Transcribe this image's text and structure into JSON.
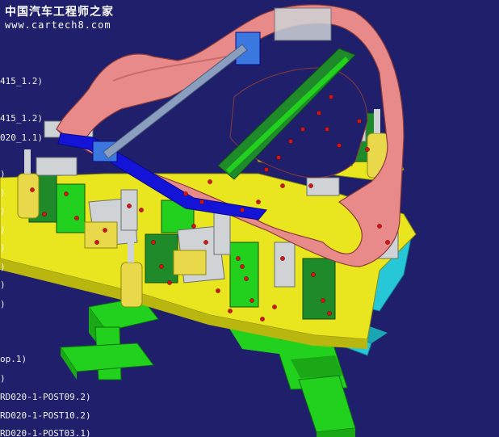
{
  "watermark": {
    "title_cn": "中国汽车工程师之家",
    "url": "www.cartech8.com"
  },
  "spec_tree": {
    "items": [
      {
        "label": "415_1.2)"
      },
      {
        "label": "415_1.2)"
      },
      {
        "label": "020_1.1)"
      },
      {
        "label": ")"
      },
      {
        "label": ")"
      },
      {
        "label": ")"
      },
      {
        "label": ")"
      },
      {
        "label": ")"
      },
      {
        "label": ")"
      },
      {
        "label": ")"
      },
      {
        "label": ")"
      },
      {
        "label": "op.1)"
      },
      {
        "label": ")"
      },
      {
        "label": "RD020-1-POST09.2)"
      },
      {
        "label": "RD020-1-POST10.2)"
      },
      {
        "label": "RD020-1-POST03.1)"
      }
    ]
  },
  "colors": {
    "background": "#1f1f6b",
    "body_panel": "#e98a8a",
    "base_plate": "#e9e51e",
    "frame": "#26c7d6",
    "stand": "#22d11d",
    "clamp_bar": "#1e8a2a",
    "locator": "#cfd3d6",
    "cylinder": "#e8d84a",
    "pin": "#d01818",
    "blue_part": "#1414d8",
    "arm": "#8a9ec0"
  }
}
